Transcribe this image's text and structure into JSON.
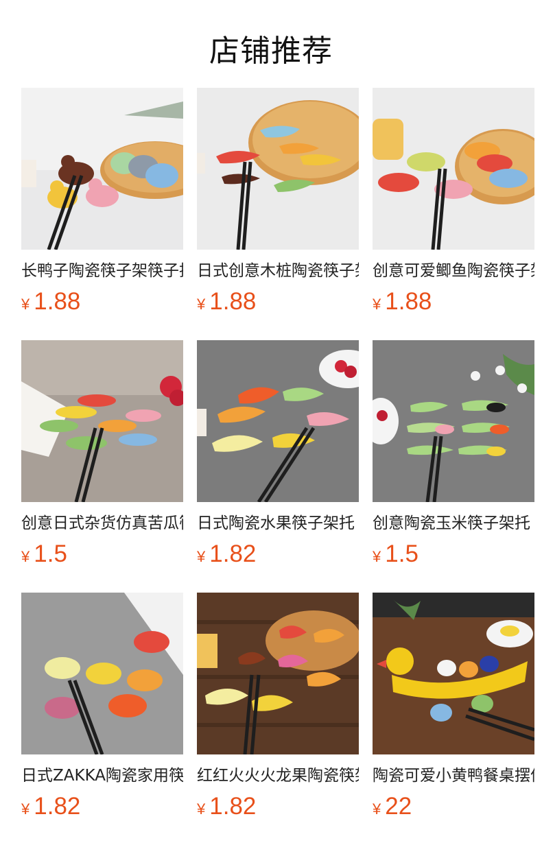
{
  "header": {
    "title": "店铺推荐"
  },
  "currency_symbol": "¥",
  "colors": {
    "price": "#e8501a",
    "text": "#222222"
  },
  "products": [
    {
      "name": "长鸭子陶瓷筷子架筷子托",
      "price": "1.88",
      "icon": "duck-chopstick-rest-photo"
    },
    {
      "name": "日式创意木桩陶瓷筷子架",
      "price": "1.88",
      "icon": "log-chopstick-rest-photo"
    },
    {
      "name": "创意可爱鲫鱼陶瓷筷子架",
      "price": "1.88",
      "icon": "fish-chopstick-rest-photo"
    },
    {
      "name": "创意日式杂货仿真苦瓜筷架",
      "price": "1.5",
      "icon": "vegetable-chopstick-rest-photo"
    },
    {
      "name": "日式陶瓷水果筷子架托",
      "price": "1.82",
      "icon": "banana-chopstick-rest-photo"
    },
    {
      "name": "创意陶瓷玉米筷子架托",
      "price": "1.5",
      "icon": "corn-chopstick-rest-photo"
    },
    {
      "name": "日式ZAKKA陶瓷家用筷架",
      "price": "1.82",
      "icon": "fruit-chopstick-rest-photo"
    },
    {
      "name": "红红火火火龙果陶瓷筷架",
      "price": "1.82",
      "icon": "dragonfruit-chopstick-rest-photo"
    },
    {
      "name": "陶瓷可爱小黄鸭餐桌摆件",
      "price": "22",
      "icon": "yellow-duck-boat-photo"
    }
  ]
}
